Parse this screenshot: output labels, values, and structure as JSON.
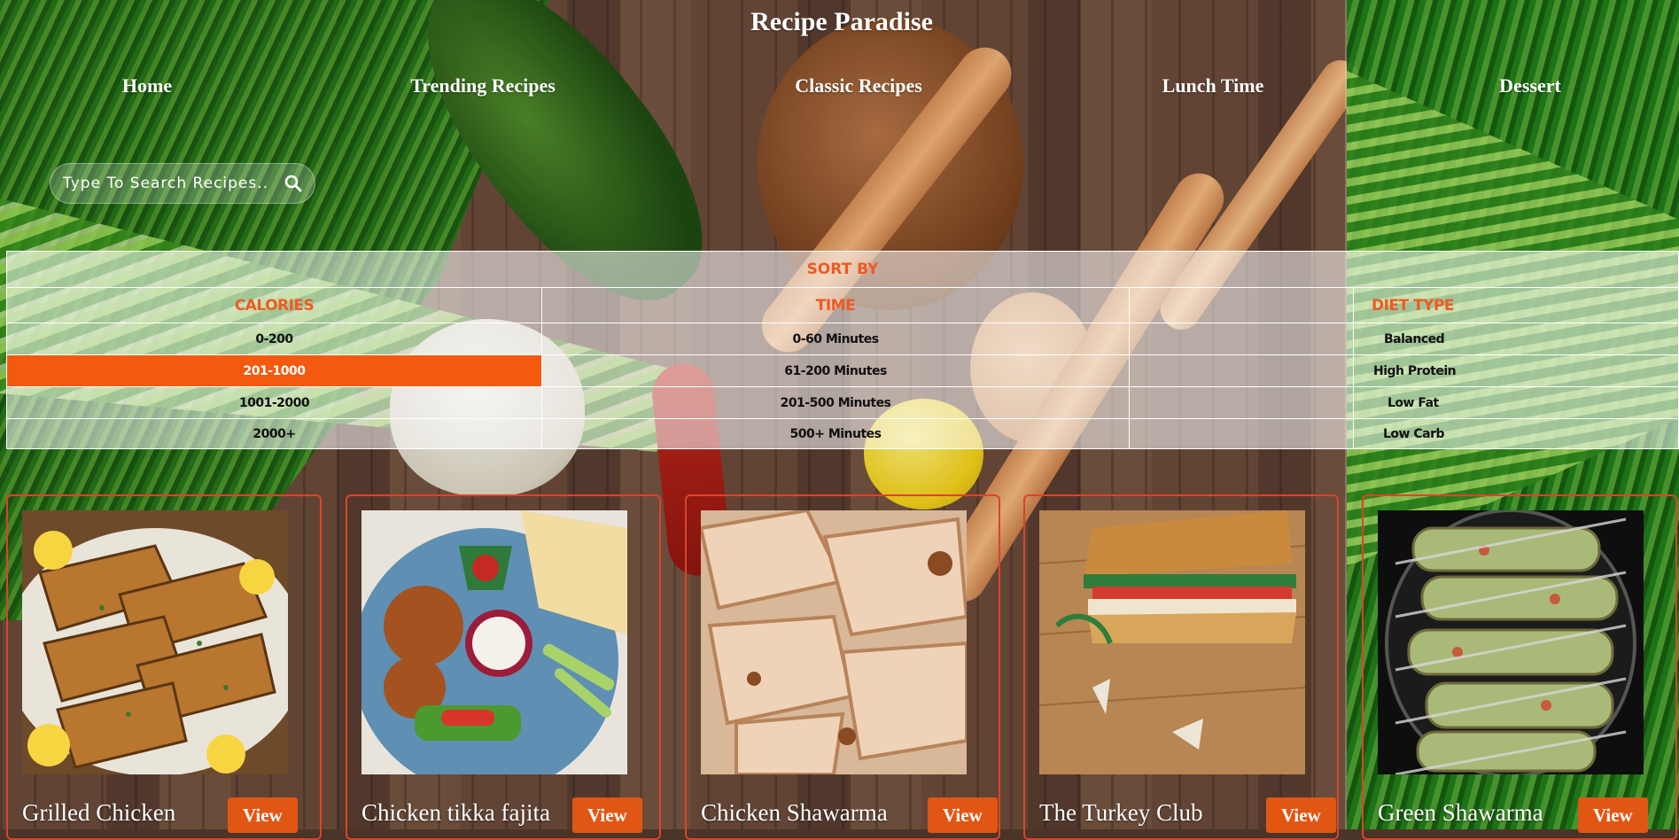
{
  "site": {
    "title": "Recipe Paradise"
  },
  "nav": {
    "items": [
      "Home",
      "Trending Recipes",
      "Classic Recipes",
      "Lunch Time",
      "Dessert"
    ]
  },
  "search": {
    "placeholder": "Type To Search Recipes..",
    "icon": "search-icon"
  },
  "sort": {
    "title": "SORT BY",
    "calories": {
      "header": "CALORIES",
      "options": [
        "0-200",
        "201-1000",
        "1001-2000",
        "2000+"
      ],
      "selected": "201-1000"
    },
    "time": {
      "header": "TIME",
      "options": [
        "0-60 Minutes",
        "61-200 Minutes",
        "201-500 Minutes",
        "500+ Minutes"
      ]
    },
    "diet": {
      "header": "DIET TYPE",
      "options": [
        "Balanced",
        "High Protein",
        "Low Fat",
        "Low Carb"
      ]
    }
  },
  "recipes": [
    {
      "name": "Grilled Chicken",
      "button": "View"
    },
    {
      "name": "Chicken tikka fajita",
      "button": "View"
    },
    {
      "name": "Chicken Shawarma",
      "button": "View"
    },
    {
      "name": "The Turkey Club",
      "button": "View"
    },
    {
      "name": "Green Shawarma",
      "button": "View"
    }
  ],
  "colors": {
    "accent": "#f05a23",
    "selected": "#f35a10",
    "button": "#e25614",
    "card_border": "#d9452a"
  }
}
